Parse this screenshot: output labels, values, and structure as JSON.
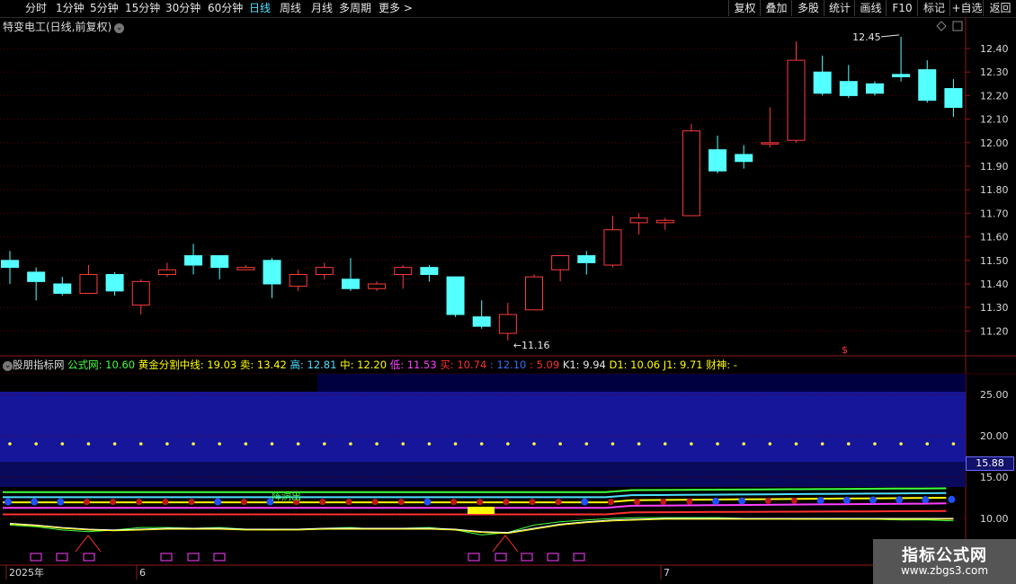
{
  "toolbar": {
    "periods": [
      "分时",
      "1分钟",
      "5分钟",
      "15分钟",
      "30分钟",
      "60分钟",
      "日线",
      "周线",
      "月线",
      "多周期",
      "更多 >"
    ],
    "active": "日线",
    "right_buttons": [
      "复权",
      "叠加",
      "多股",
      "统计",
      "画线",
      "F10",
      "标记",
      "+自选",
      "返回"
    ]
  },
  "main": {
    "title": "特变电工(日线,前复权)",
    "high_annotation": "12.45",
    "low_annotation": "11.16",
    "price_axis": [
      "12.40",
      "12.30",
      "12.20",
      "12.10",
      "12.00",
      "11.90",
      "11.80",
      "11.70",
      "11.60",
      "11.50",
      "11.40",
      "11.30",
      "11.20"
    ],
    "marker": "$"
  },
  "indicator": {
    "name": "股朋指标网",
    "values": [
      {
        "label": "公式网: ",
        "value": "10.60",
        "color": "#41ff41"
      },
      {
        "label": "黄金分割中线: ",
        "value": "19.03",
        "color": "#ffff00"
      },
      {
        "label": "卖: ",
        "value": "13.42",
        "color": "#ffff00"
      },
      {
        "label": "高: ",
        "value": "12.81",
        "color": "#4fe0ff"
      },
      {
        "label": "中: ",
        "value": "12.20",
        "color": "#ffff00"
      },
      {
        "label": "低: ",
        "value": "11.53",
        "color": "#ff40ff"
      },
      {
        "label": "买: ",
        "value": "10.74",
        "color": "#ff3030"
      },
      {
        "label": ": ",
        "value": "12.10",
        "color": "#3a6bff"
      },
      {
        "label": ": ",
        "value": "5.09",
        "color": "#ff3030"
      },
      {
        "label": "K1: ",
        "value": "9.94",
        "color": "#e6e6e6"
      },
      {
        "label": "D1: ",
        "value": "10.06",
        "color": "#ffff00"
      },
      {
        "label": "J1: ",
        "value": "9.71",
        "color": "#ffff00"
      },
      {
        "label": "财神: ",
        "value": "-",
        "color": "#ffff00"
      }
    ],
    "axis": [
      "25.00",
      "20.00",
      "15.00",
      "10.00"
    ],
    "current_value": "15.88",
    "signal_text": "阵洞出"
  },
  "date_axis": [
    "2025年",
    "6",
    "7"
  ],
  "watermark": {
    "line1": "指标公式网",
    "line2": "www.zbgs3.com"
  },
  "chart_data": {
    "type": "candlestick",
    "title": "特变电工(日线,前复权)",
    "ylim": [
      11.15,
      12.48
    ],
    "candles": [
      {
        "o": 11.5,
        "c": 11.47,
        "h": 11.54,
        "l": 11.4
      },
      {
        "o": 11.45,
        "c": 11.41,
        "h": 11.47,
        "l": 11.33
      },
      {
        "o": 11.4,
        "c": 11.36,
        "h": 11.43,
        "l": 11.35
      },
      {
        "o": 11.36,
        "c": 11.44,
        "h": 11.48,
        "l": 11.36
      },
      {
        "o": 11.44,
        "c": 11.37,
        "h": 11.45,
        "l": 11.35
      },
      {
        "o": 11.31,
        "c": 11.41,
        "h": 11.42,
        "l": 11.27
      },
      {
        "o": 11.44,
        "c": 11.46,
        "h": 11.49,
        "l": 11.43
      },
      {
        "o": 11.52,
        "c": 11.48,
        "h": 11.57,
        "l": 11.44
      },
      {
        "o": 11.52,
        "c": 11.47,
        "h": 11.52,
        "l": 11.42
      },
      {
        "o": 11.46,
        "c": 11.47,
        "h": 11.48,
        "l": 11.46
      },
      {
        "o": 11.5,
        "c": 11.4,
        "h": 11.51,
        "l": 11.34
      },
      {
        "o": 11.39,
        "c": 11.44,
        "h": 11.46,
        "l": 11.37
      },
      {
        "o": 11.44,
        "c": 11.47,
        "h": 11.49,
        "l": 11.42
      },
      {
        "o": 11.42,
        "c": 11.38,
        "h": 11.51,
        "l": 11.37
      },
      {
        "o": 11.38,
        "c": 11.4,
        "h": 11.41,
        "l": 11.37
      },
      {
        "o": 11.44,
        "c": 11.47,
        "h": 11.48,
        "l": 11.38
      },
      {
        "o": 11.47,
        "c": 11.44,
        "h": 11.48,
        "l": 11.41
      },
      {
        "o": 11.43,
        "c": 11.27,
        "h": 11.43,
        "l": 11.26
      },
      {
        "o": 11.26,
        "c": 11.22,
        "h": 11.33,
        "l": 11.21
      },
      {
        "o": 11.19,
        "c": 11.27,
        "h": 11.32,
        "l": 11.16
      },
      {
        "o": 11.29,
        "c": 11.43,
        "h": 11.44,
        "l": 11.29
      },
      {
        "o": 11.46,
        "c": 11.52,
        "h": 11.52,
        "l": 11.41
      },
      {
        "o": 11.52,
        "c": 11.49,
        "h": 11.54,
        "l": 11.44
      },
      {
        "o": 11.48,
        "c": 11.63,
        "h": 11.69,
        "l": 11.47
      },
      {
        "o": 11.66,
        "c": 11.68,
        "h": 11.7,
        "l": 11.61
      },
      {
        "o": 11.66,
        "c": 11.67,
        "h": 11.68,
        "l": 11.63
      },
      {
        "o": 11.69,
        "c": 12.05,
        "h": 12.08,
        "l": 11.69
      },
      {
        "o": 11.97,
        "c": 11.88,
        "h": 12.03,
        "l": 11.87
      },
      {
        "o": 11.95,
        "c": 11.92,
        "h": 11.99,
        "l": 11.89
      },
      {
        "o": 12.0,
        "c": 12.0,
        "h": 12.15,
        "l": 11.98
      },
      {
        "o": 12.01,
        "c": 12.35,
        "h": 12.43,
        "l": 12.0
      },
      {
        "o": 12.3,
        "c": 12.21,
        "h": 12.37,
        "l": 12.2
      },
      {
        "o": 12.26,
        "c": 12.2,
        "h": 12.33,
        "l": 12.19
      },
      {
        "o": 12.25,
        "c": 12.21,
        "h": 12.26,
        "l": 12.2
      },
      {
        "o": 12.29,
        "c": 12.28,
        "h": 12.45,
        "l": 12.26
      },
      {
        "o": 12.31,
        "c": 12.18,
        "h": 12.35,
        "l": 12.17
      },
      {
        "o": 12.23,
        "c": 12.15,
        "h": 12.27,
        "l": 12.11
      }
    ]
  }
}
